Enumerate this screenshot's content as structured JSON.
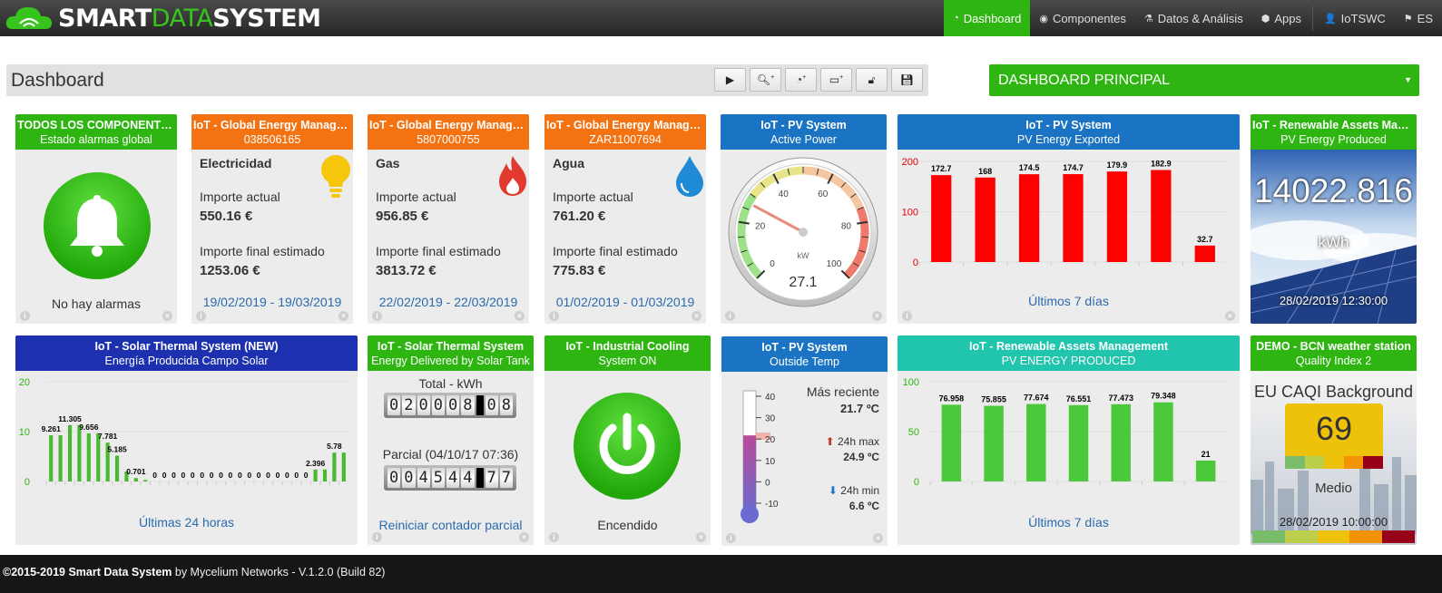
{
  "header": {
    "logo_part1": "SMART",
    "logo_part2": "DATA",
    "logo_part3": "SYSTEM",
    "nav": [
      {
        "label": "Dashboard",
        "icon": "dashboard-icon"
      },
      {
        "label": "Componentes",
        "icon": "target-icon"
      },
      {
        "label": "Datos & Análisis",
        "icon": "flask-icon"
      },
      {
        "label": "Apps",
        "icon": "cube-icon"
      },
      {
        "label": "IoTSWC",
        "icon": "user-icon"
      },
      {
        "label": "ES",
        "icon": "flag-icon"
      }
    ]
  },
  "toolbar": {
    "title": "Dashboard",
    "buttons": [
      "play-icon",
      "zoom-plus-icon",
      "gauge-plus-icon",
      "window-plus-icon",
      "unlock-icon",
      "save-icon"
    ]
  },
  "dashboard_select": {
    "value": "DASHBOARD PRINCIPAL"
  },
  "widgets": {
    "alarms": {
      "title": "TODOS LOS COMPONENTES",
      "subtitle": "Estado alarmas global",
      "status": "No hay alarmas"
    },
    "elec": {
      "title": "IoT - Global Energy Managem...",
      "subtitle": "038506165",
      "type": "Electricidad",
      "label1": "Importe actual",
      "value1": "550.16 €",
      "label2": "Importe final estimado",
      "value2": "1253.06 €",
      "period": "19/02/2019 - 19/03/2019"
    },
    "gas": {
      "title": "IoT - Global Energy Managem...",
      "subtitle": "5807000755",
      "type": "Gas",
      "label1": "Importe actual",
      "value1": "956.85 €",
      "label2": "Importe final estimado",
      "value2": "3813.72 €",
      "period": "22/02/2019 - 22/03/2019"
    },
    "agua": {
      "title": "IoT - Global Energy Managem...",
      "subtitle": "ZAR11007694",
      "type": "Agua",
      "label1": "Importe actual",
      "value1": "761.20 €",
      "label2": "Importe final estimado",
      "value2": "775.83 €",
      "period": "01/02/2019 - 01/03/2019"
    },
    "pv_power": {
      "title": "IoT - PV System",
      "subtitle": "Active Power",
      "unit": "kW",
      "value": "27.1",
      "gauge_value": 27.1,
      "ticks": [
        "0",
        "20",
        "40",
        "60",
        "80",
        "100"
      ]
    },
    "pv_exported": {
      "title": "IoT - PV System",
      "subtitle": "PV Energy Exported",
      "footer": "Últimos 7 días"
    },
    "renewable_produced": {
      "title": "IoT - Renewable Assets Mana...",
      "subtitle": "PV Energy Produced",
      "value": "14022.816",
      "unit": "kWh",
      "timestamp": "28/02/2019 12:30:00"
    },
    "solar_thermal_new": {
      "title": "IoT - Solar Thermal System (NEW)",
      "subtitle": "Energía Producida Campo Solar",
      "footer": "Últimas 24 horas"
    },
    "solar_thermal": {
      "title": "IoT - Solar Thermal System",
      "subtitle": "Energy Delivered by Solar Tank",
      "total_label": "Total - kWh",
      "total_digits": [
        "0",
        "2",
        "0",
        "0",
        "0",
        "8",
        ".",
        "0",
        "8"
      ],
      "partial_label": "Parcial (04/10/17 07:36)",
      "partial_digits": [
        "0",
        "0",
        "4",
        "5",
        "4",
        "4",
        ".",
        "7",
        "7"
      ],
      "reset_link": "Reiniciar contador parcial"
    },
    "cooling": {
      "title": "IoT - Industrial Cooling",
      "subtitle": "System ON",
      "status": "Encendido"
    },
    "outside_temp": {
      "title": "IoT - PV System",
      "subtitle": "Outside Temp",
      "recent_label": "Más reciente",
      "recent_value": "21.7 ºC",
      "max_label": "24h max",
      "max_value": "24.9 ºC",
      "min_label": "24h min",
      "min_value": "6.6 ºC",
      "scale": [
        "40",
        "30",
        "20",
        "10",
        "0",
        "-10"
      ],
      "level_c": 21.7
    },
    "renewable_bars": {
      "title": "IoT - Renewable Assets Management",
      "subtitle": "PV ENERGY PRODUCED",
      "footer": "Últimos 7 días"
    },
    "weather": {
      "title": "DEMO - BCN weather station",
      "subtitle": "Quality Index 2",
      "label": "EU CAQI Background",
      "value": "69",
      "quality": "Medio",
      "timestamp": "28/02/2019 10:00:00",
      "legend_colors": [
        "#79bc6a",
        "#bbcf4c",
        "#eec20b",
        "#f29305",
        "#960018"
      ]
    }
  },
  "chart_data": [
    {
      "id": "pv_exported",
      "type": "bar",
      "categories": [
        "",
        "",
        "",
        "",
        "",
        "",
        ""
      ],
      "values": [
        172.7,
        168,
        174.5,
        174.7,
        179.9,
        182.9,
        32.7
      ],
      "labels": [
        "172.7",
        "168",
        "174.5",
        "174.7",
        "179.9",
        "182.9",
        "32.7"
      ],
      "ylim": [
        0,
        200
      ],
      "yticks": [
        "0",
        "100",
        "200"
      ],
      "color": "#ff0000",
      "tick_color": "#e00000"
    },
    {
      "id": "solar_thermal_new",
      "type": "bar",
      "values": [
        9.261,
        9.261,
        11.305,
        11.305,
        9.656,
        9.656,
        7.781,
        5.185,
        2.0,
        0.701,
        0.3,
        0,
        0,
        0,
        0,
        0,
        0,
        0,
        0,
        0,
        0,
        0,
        0,
        0,
        0,
        0,
        0,
        0,
        2.396,
        2.396,
        5.78,
        5.78
      ],
      "labels": [
        "9.261",
        "",
        "11.305",
        "",
        "9.656",
        "",
        "7.781",
        "5.185",
        "",
        "0.701",
        "",
        "0",
        "0",
        "0",
        "0",
        "0",
        "0",
        "0",
        "0",
        "0",
        "0",
        "0",
        "0",
        "0",
        "0",
        "0",
        "0",
        "0",
        "2.396",
        "",
        "5.78",
        ""
      ],
      "ylim": [
        0,
        20
      ],
      "yticks": [
        "0",
        "10",
        "20"
      ],
      "color": "#49b833",
      "tick_color": "#2eb511"
    },
    {
      "id": "renewable_bars",
      "type": "bar",
      "categories": [
        "",
        "",
        "",
        "",
        "",
        "",
        ""
      ],
      "values": [
        76.958,
        75.855,
        77.674,
        76.551,
        77.473,
        79.348,
        21
      ],
      "labels": [
        "76.958",
        "75.855",
        "77.674",
        "76.551",
        "77.473",
        "79.348",
        "21"
      ],
      "ylim": [
        0,
        100
      ],
      "yticks": [
        "0",
        "50",
        "100"
      ],
      "color": "#4cc93a",
      "tick_color": "#2eb511"
    }
  ],
  "footer": {
    "copyright": "©2015-2019 Smart Data System",
    "by": " by Mycelium Networks - V.1.2.0 (Build 82)"
  }
}
